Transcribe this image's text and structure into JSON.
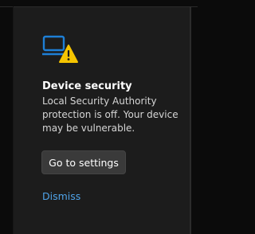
{
  "notification": {
    "icon": "laptop-warning-icon",
    "title": "Device security",
    "message": "Local Security Authority protection is off. Your device may be vulnerable.",
    "primary_button": "Go to settings",
    "dismiss_link": "Dismiss"
  },
  "colors": {
    "background": "#0b0b0b",
    "card": "#1c1c1c",
    "accent": "#1e7fd6",
    "warning": "#f5c400",
    "link": "#4fa3e8",
    "button": "#3a3a3a"
  }
}
